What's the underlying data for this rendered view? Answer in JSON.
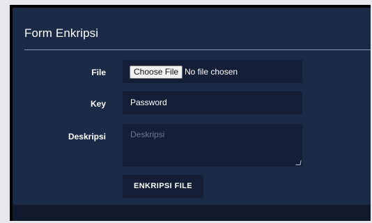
{
  "form": {
    "title": "Form Enkripsi",
    "file": {
      "label": "File",
      "button_label": "Choose File",
      "status": "No file chosen"
    },
    "key": {
      "label": "Key",
      "value": "Password"
    },
    "description": {
      "label": "Deskripsi",
      "placeholder": "Deskripsi"
    },
    "submit_label": "ENKRIPSI FILE"
  },
  "colors": {
    "panel_background": "#1b2a47",
    "field_background": "#141f37",
    "text": "#ffffff"
  }
}
